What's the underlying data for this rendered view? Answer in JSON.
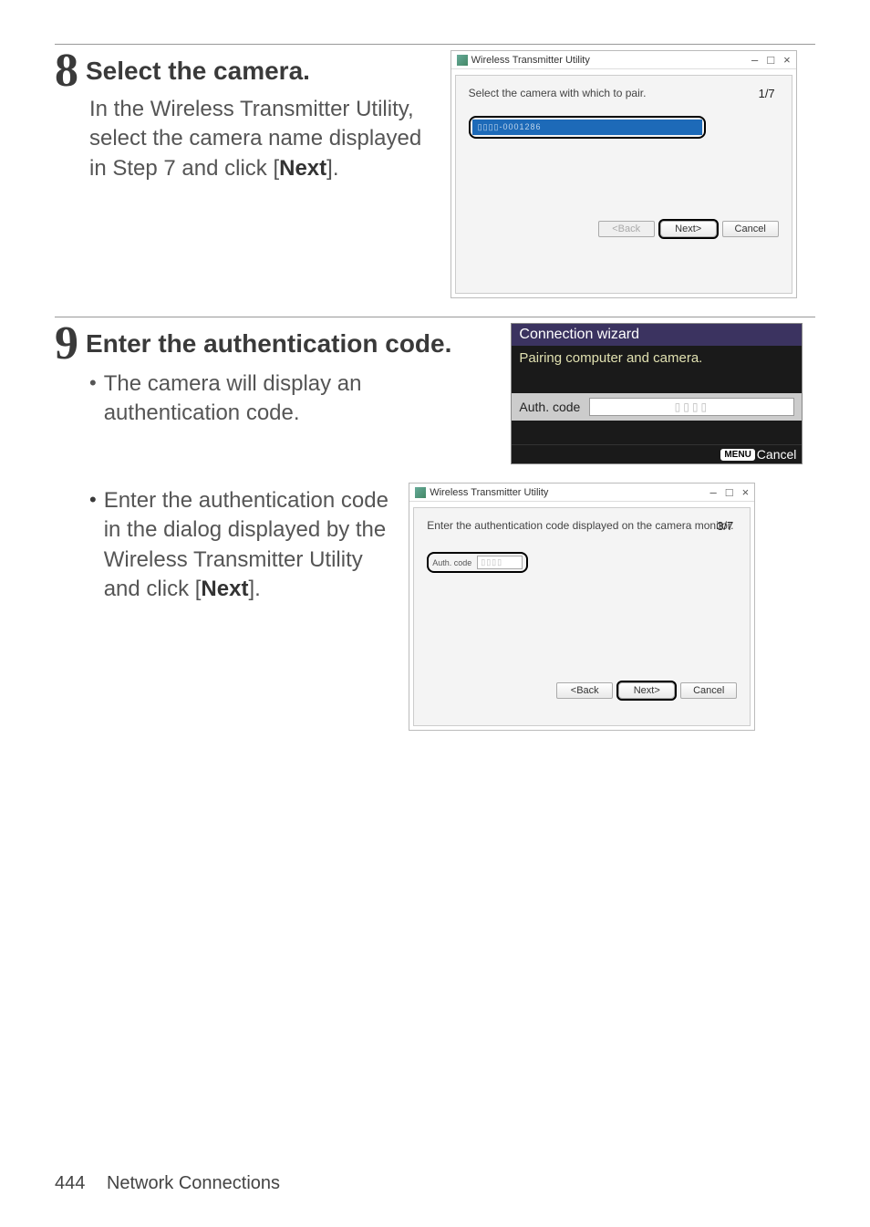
{
  "step8": {
    "num": "8",
    "title": "Select the camera.",
    "body_pre": "In the Wireless Transmitter Utility, select the camera name displayed in Step 7 and click [",
    "body_bold": "Next",
    "body_post": "]."
  },
  "step9": {
    "num": "9",
    "title": "Enter the authentication code.",
    "bullet1": "The camera will display an authentication code.",
    "bullet2_pre": "Enter the authentication code in the dialog displayed by the Wireless Transmitter Utility and click [",
    "bullet2_bold": "Next",
    "bullet2_post": "]."
  },
  "dialog1": {
    "title": "Wireless Transmitter Utility",
    "msg": "Select the camera with which to pair.",
    "page": "1/7",
    "camera_item": "▯▯▯▯-0001286",
    "btn_back": "<Back",
    "btn_next": "Next>",
    "btn_cancel": "Cancel"
  },
  "camlcd": {
    "title": "Connection wizard",
    "subtitle": "Pairing computer and camera.",
    "auth_label": "Auth. code",
    "auth_value": "▯▯▯▯",
    "menu_icon": "MENU",
    "cancel": "Cancel"
  },
  "dialog2": {
    "title": "Wireless Transmitter Utility",
    "msg": "Enter the authentication code displayed on the camera monitor.",
    "page": "3/7",
    "auth_label": "Auth. code",
    "auth_value": "▯▯▯▯",
    "btn_back": "<Back",
    "btn_next": "Next>",
    "btn_cancel": "Cancel"
  },
  "footer": {
    "page": "444",
    "section": "Network Connections"
  },
  "win": {
    "min": "–",
    "max": "□",
    "close": "×"
  }
}
